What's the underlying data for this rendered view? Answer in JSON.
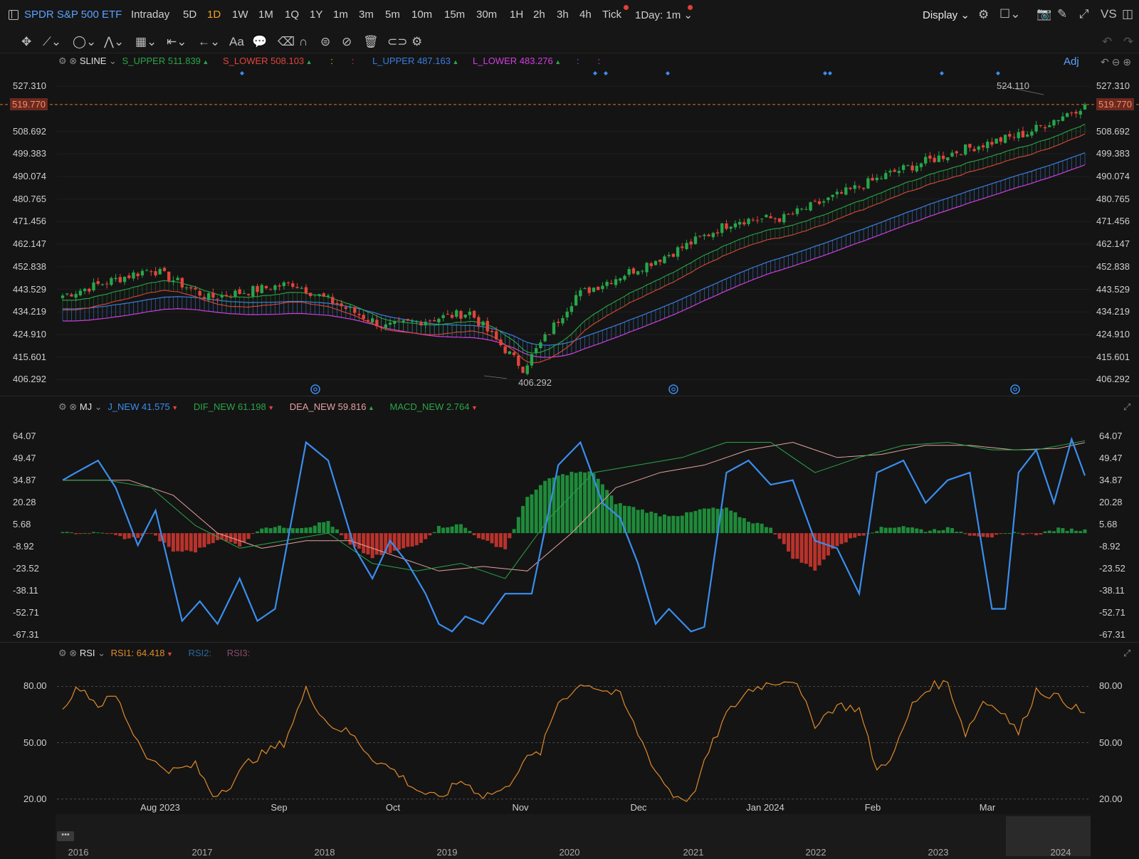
{
  "header": {
    "symbol_name": "SPDR S&P 500 ETF",
    "timeframes": [
      "Intraday",
      "5D",
      "1D",
      "1W",
      "1M",
      "1Q",
      "1Y",
      "1m",
      "3m",
      "5m",
      "10m",
      "15m",
      "30m",
      "1H",
      "2h",
      "3h",
      "4h",
      "Tick"
    ],
    "active_timeframe": "1D",
    "interval_select": "1Day: 1m",
    "display_label": "Display",
    "vs_label": "VS"
  },
  "main_pane": {
    "indicator": "SLINE",
    "s_upper_label": "S_UPPER",
    "s_upper_value": "511.839",
    "s_lower_label": "S_LOWER",
    "s_lower_value": "508.103",
    "l_upper_label": "L_UPPER",
    "l_upper_value": "487.163",
    "l_lower_label": "L_LOWER",
    "l_lower_value": "483.276",
    "adj_label": "Adj",
    "current_price": "519.770",
    "high_label": "524.110",
    "low_label": "406.292",
    "y_ticks": [
      "527.310",
      "508.692",
      "499.383",
      "490.074",
      "480.765",
      "471.456",
      "462.147",
      "452.838",
      "443.529",
      "434.219",
      "424.910",
      "415.601",
      "406.292"
    ]
  },
  "macd_pane": {
    "indicator": "MJ",
    "j_label": "J_NEW",
    "j_value": "41.575",
    "dif_label": "DIF_NEW",
    "dif_value": "61.198",
    "dea_label": "DEA_NEW",
    "dea_value": "59.816",
    "macd_label": "MACD_NEW",
    "macd_value": "2.764",
    "y_ticks": [
      "64.07",
      "49.47",
      "34.87",
      "20.28",
      "5.68",
      "-8.92",
      "-23.52",
      "-38.11",
      "-52.71",
      "-67.31"
    ]
  },
  "rsi_pane": {
    "indicator": "RSI",
    "rsi1_label": "RSI1: 64.418",
    "rsi2_label": "RSI2:",
    "rsi3_label": "RSI3:",
    "y_ticks": [
      "80.00",
      "50.00",
      "20.00"
    ]
  },
  "x_axis": [
    "Aug 2023",
    "Sep",
    "Oct",
    "Nov",
    "Dec",
    "Jan 2024",
    "Feb",
    "Mar"
  ],
  "navigator_years": [
    "2016",
    "2017",
    "2018",
    "2019",
    "2020",
    "2021",
    "2022",
    "2023",
    "2024"
  ],
  "colors": {
    "up": "#26a64a",
    "down": "#e0453b",
    "s_band": "#2aa54a",
    "s_lower": "#e0453b",
    "l_upper": "#3b7ddd",
    "l_lower": "#d23ee0",
    "j_line": "#3a8ef0",
    "rsi": "#e08a2a"
  },
  "chart_data": [
    {
      "type": "candlestick",
      "title": "SPDR S&P 500 ETF",
      "x_start": "2023-07-10",
      "x_end": "2024-03-22",
      "ylim": [
        402,
        530
      ],
      "anchors": [
        [
          0,
          441
        ],
        [
          20,
          452
        ],
        [
          33,
          440
        ],
        [
          52,
          446
        ],
        [
          73,
          428
        ],
        [
          92,
          434
        ],
        [
          104,
          411
        ],
        [
          116,
          441
        ],
        [
          137,
          458
        ],
        [
          152,
          472
        ],
        [
          163,
          473
        ],
        [
          188,
          492
        ],
        [
          203,
          501
        ],
        [
          218,
          508
        ],
        [
          231,
          519.77
        ]
      ],
      "last_close": 519.77,
      "period_high": 524.11,
      "period_low": 406.292
    },
    {
      "type": "line",
      "title": "MJ",
      "ylim": [
        -70,
        72
      ],
      "j_points": [
        [
          0,
          35
        ],
        [
          3,
          40
        ],
        [
          8,
          48
        ],
        [
          12,
          30
        ],
        [
          17,
          -8
        ],
        [
          21,
          15
        ],
        [
          27,
          -58
        ],
        [
          31,
          -45
        ],
        [
          35,
          -60
        ],
        [
          40,
          -30
        ],
        [
          44,
          -58
        ],
        [
          48,
          -50
        ],
        [
          55,
          60
        ],
        [
          60,
          48
        ],
        [
          66,
          -10
        ],
        [
          70,
          -30
        ],
        [
          74,
          -5
        ],
        [
          78,
          -20
        ],
        [
          82,
          -40
        ],
        [
          85,
          -60
        ],
        [
          88,
          -65
        ],
        [
          91,
          -55
        ],
        [
          95,
          -60
        ],
        [
          100,
          -40
        ],
        [
          106,
          -40
        ],
        [
          112,
          45
        ],
        [
          117,
          60
        ],
        [
          122,
          20
        ],
        [
          126,
          10
        ],
        [
          130,
          -20
        ],
        [
          134,
          -60
        ],
        [
          137,
          -50
        ],
        [
          142,
          -65
        ],
        [
          145,
          -62
        ],
        [
          150,
          40
        ],
        [
          155,
          48
        ],
        [
          160,
          32
        ],
        [
          165,
          35
        ],
        [
          170,
          -5
        ],
        [
          175,
          -10
        ],
        [
          180,
          -40
        ],
        [
          184,
          40
        ],
        [
          190,
          48
        ],
        [
          195,
          20
        ],
        [
          200,
          35
        ],
        [
          205,
          40
        ],
        [
          210,
          -50
        ],
        [
          213,
          -50
        ],
        [
          216,
          40
        ],
        [
          220,
          55
        ],
        [
          224,
          20
        ],
        [
          228,
          62
        ],
        [
          231,
          38
        ]
      ],
      "dif_points": [
        [
          0,
          35
        ],
        [
          10,
          35
        ],
        [
          20,
          30
        ],
        [
          30,
          5
        ],
        [
          40,
          -10
        ],
        [
          50,
          -5
        ],
        [
          60,
          0
        ],
        [
          70,
          -20
        ],
        [
          80,
          -25
        ],
        [
          90,
          -20
        ],
        [
          100,
          -30
        ],
        [
          110,
          10
        ],
        [
          120,
          40
        ],
        [
          130,
          45
        ],
        [
          140,
          50
        ],
        [
          150,
          60
        ],
        [
          160,
          60
        ],
        [
          170,
          40
        ],
        [
          180,
          50
        ],
        [
          190,
          58
        ],
        [
          200,
          60
        ],
        [
          210,
          55
        ],
        [
          220,
          55
        ],
        [
          231,
          61
        ]
      ],
      "dea_points": [
        [
          0,
          35
        ],
        [
          15,
          35
        ],
        [
          25,
          25
        ],
        [
          35,
          0
        ],
        [
          45,
          -10
        ],
        [
          55,
          -5
        ],
        [
          65,
          -5
        ],
        [
          75,
          -15
        ],
        [
          85,
          -25
        ],
        [
          95,
          -22
        ],
        [
          105,
          -25
        ],
        [
          115,
          0
        ],
        [
          125,
          30
        ],
        [
          135,
          40
        ],
        [
          145,
          45
        ],
        [
          155,
          55
        ],
        [
          165,
          60
        ],
        [
          175,
          50
        ],
        [
          185,
          52
        ],
        [
          195,
          58
        ],
        [
          205,
          58
        ],
        [
          215,
          55
        ],
        [
          225,
          56
        ],
        [
          231,
          59.8
        ]
      ],
      "macd_bars_note": "histogram of 2*(DIF-DEA)"
    },
    {
      "type": "line",
      "title": "RSI",
      "ylim": [
        15,
        90
      ],
      "rsi_points": [
        [
          0,
          70
        ],
        [
          4,
          80
        ],
        [
          8,
          70
        ],
        [
          12,
          75
        ],
        [
          16,
          55
        ],
        [
          20,
          40
        ],
        [
          25,
          35
        ],
        [
          30,
          38
        ],
        [
          34,
          22
        ],
        [
          38,
          28
        ],
        [
          42,
          40
        ],
        [
          46,
          45
        ],
        [
          50,
          50
        ],
        [
          55,
          78
        ],
        [
          60,
          60
        ],
        [
          65,
          55
        ],
        [
          70,
          42
        ],
        [
          75,
          35
        ],
        [
          80,
          25
        ],
        [
          85,
          20
        ],
        [
          90,
          30
        ],
        [
          95,
          22
        ],
        [
          100,
          25
        ],
        [
          104,
          40
        ],
        [
          108,
          45
        ],
        [
          112,
          72
        ],
        [
          118,
          82
        ],
        [
          122,
          78
        ],
        [
          126,
          75
        ],
        [
          130,
          55
        ],
        [
          134,
          35
        ],
        [
          138,
          22
        ],
        [
          142,
          20
        ],
        [
          146,
          45
        ],
        [
          150,
          65
        ],
        [
          155,
          78
        ],
        [
          160,
          82
        ],
        [
          165,
          84
        ],
        [
          170,
          60
        ],
        [
          175,
          70
        ],
        [
          180,
          68
        ],
        [
          184,
          35
        ],
        [
          188,
          45
        ],
        [
          192,
          70
        ],
        [
          196,
          80
        ],
        [
          200,
          82
        ],
        [
          204,
          55
        ],
        [
          208,
          72
        ],
        [
          212,
          68
        ],
        [
          216,
          55
        ],
        [
          220,
          78
        ],
        [
          224,
          75
        ],
        [
          228,
          70
        ],
        [
          231,
          64.4
        ]
      ]
    }
  ]
}
